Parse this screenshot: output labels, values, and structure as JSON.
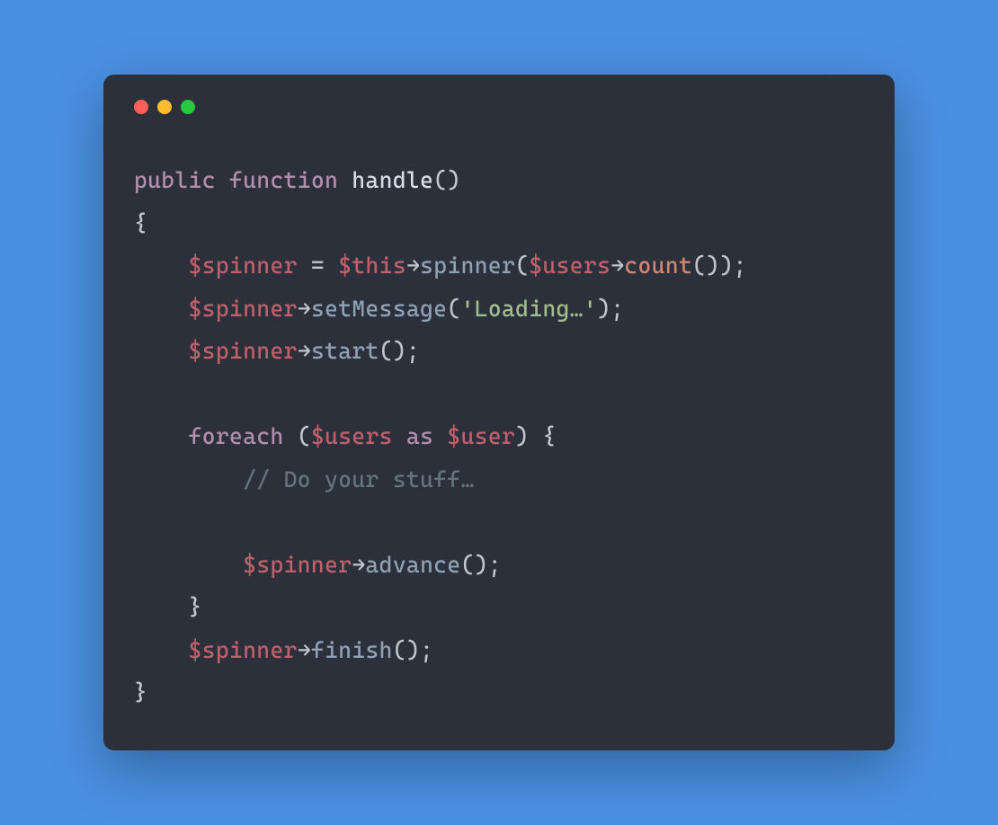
{
  "window": {
    "traffic": {
      "red": "close-icon",
      "yellow": "minimize-icon",
      "green": "maximize-icon"
    }
  },
  "code": {
    "line1_public": "public",
    "line1_function": "function",
    "line1_name": "handle",
    "line1_parens": "()",
    "line2_brace": "{",
    "line3_var": "$spinner",
    "line3_eq": " = ",
    "line3_this": "$this",
    "line3_arrow": "→",
    "line3_spinner": "spinner",
    "line3_open": "(",
    "line3_users": "$users",
    "line3_arrow2": "→",
    "line3_count": "count",
    "line3_close": "());",
    "line4_var": "$spinner",
    "line4_arrow": "→",
    "line4_setmsg": "setMessage",
    "line4_open": "(",
    "line4_str": "'Loading…'",
    "line4_close": ");",
    "line5_var": "$spinner",
    "line5_arrow": "→",
    "line5_start": "start",
    "line5_close": "();",
    "line7_foreach": "foreach",
    "line7_open": " (",
    "line7_users": "$users",
    "line7_as": " as ",
    "line7_user": "$user",
    "line7_close": ") {",
    "line8_comment": "// Do your stuff…",
    "line10_var": "$spinner",
    "line10_arrow": "→",
    "line10_advance": "advance",
    "line10_close": "();",
    "line11_brace": "}",
    "line12_var": "$spinner",
    "line12_arrow": "→",
    "line12_finish": "finish",
    "line12_close": "();",
    "line13_brace": "}"
  }
}
